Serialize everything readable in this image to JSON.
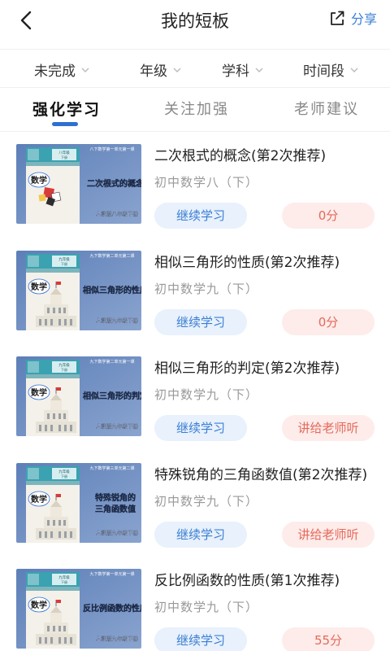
{
  "header": {
    "title": "我的短板",
    "share_label": "分享"
  },
  "filters": [
    "未完成",
    "年级",
    "学科",
    "时间段"
  ],
  "tabs": [
    {
      "label": "强化学习",
      "active": true
    },
    {
      "label": "关注加强",
      "active": false
    },
    {
      "label": "老师建议",
      "active": false
    }
  ],
  "colors": {
    "accent": "#2f6fd1",
    "continue_bg": "#e8f1fc",
    "continue_text": "#3b7ed3",
    "score_bg": "#fdecea",
    "score_text": "#e5695a"
  },
  "items": [
    {
      "title": "二次根式的概念(第2次推荐)",
      "subtitle": "初中数学八（下）",
      "continue_label": "继续学习",
      "right_label": "0分",
      "thumb": {
        "top_caption": "八下数学第一单元第一课",
        "book": "数学",
        "grade": "八年级",
        "volume": "下册",
        "topic_lines": [
          "二次根式的概念"
        ],
        "publisher": "人教版八年级下册",
        "art": "tiles"
      }
    },
    {
      "title": "相似三角形的性质(第2次推荐)",
      "subtitle": "初中数学九（下）",
      "continue_label": "继续学习",
      "right_label": "0分",
      "thumb": {
        "top_caption": "九下数学第二单元第二课",
        "book": "数学",
        "grade": "九年级",
        "volume": "下册",
        "topic_lines": [
          "相似三角形的性质"
        ],
        "publisher": "人教版九年级下册",
        "art": "building"
      }
    },
    {
      "title": "相似三角形的判定(第2次推荐)",
      "subtitle": "初中数学九（下）",
      "continue_label": "继续学习",
      "right_label": "讲给老师听",
      "thumb": {
        "top_caption": "九下数学第二单元第一课",
        "book": "数学",
        "grade": "九年级",
        "volume": "下册",
        "topic_lines": [
          "相似三角形的判定"
        ],
        "publisher": "人教版九年级下册",
        "art": "building"
      }
    },
    {
      "title": "特殊锐角的三角函数值(第2次推荐)",
      "subtitle": "初中数学九（下）",
      "continue_label": "继续学习",
      "right_label": "讲给老师听",
      "thumb": {
        "top_caption": "九下数学第三单元第二课",
        "book": "数学",
        "grade": "九年级",
        "volume": "下册",
        "topic_lines": [
          "特殊锐角的",
          "三角函数值"
        ],
        "publisher": "人教版九年级下册",
        "art": "building"
      }
    },
    {
      "title": "反比例函数的性质(第1次推荐)",
      "subtitle": "初中数学九（下）",
      "continue_label": "继续学习",
      "right_label": "55分",
      "thumb": {
        "top_caption": "九下数学第一单元第一课",
        "book": "数学",
        "grade": "九年级",
        "volume": "下册",
        "topic_lines": [
          "反比例函数的性质"
        ],
        "publisher": "人教版九年级下册",
        "art": "building"
      }
    }
  ]
}
